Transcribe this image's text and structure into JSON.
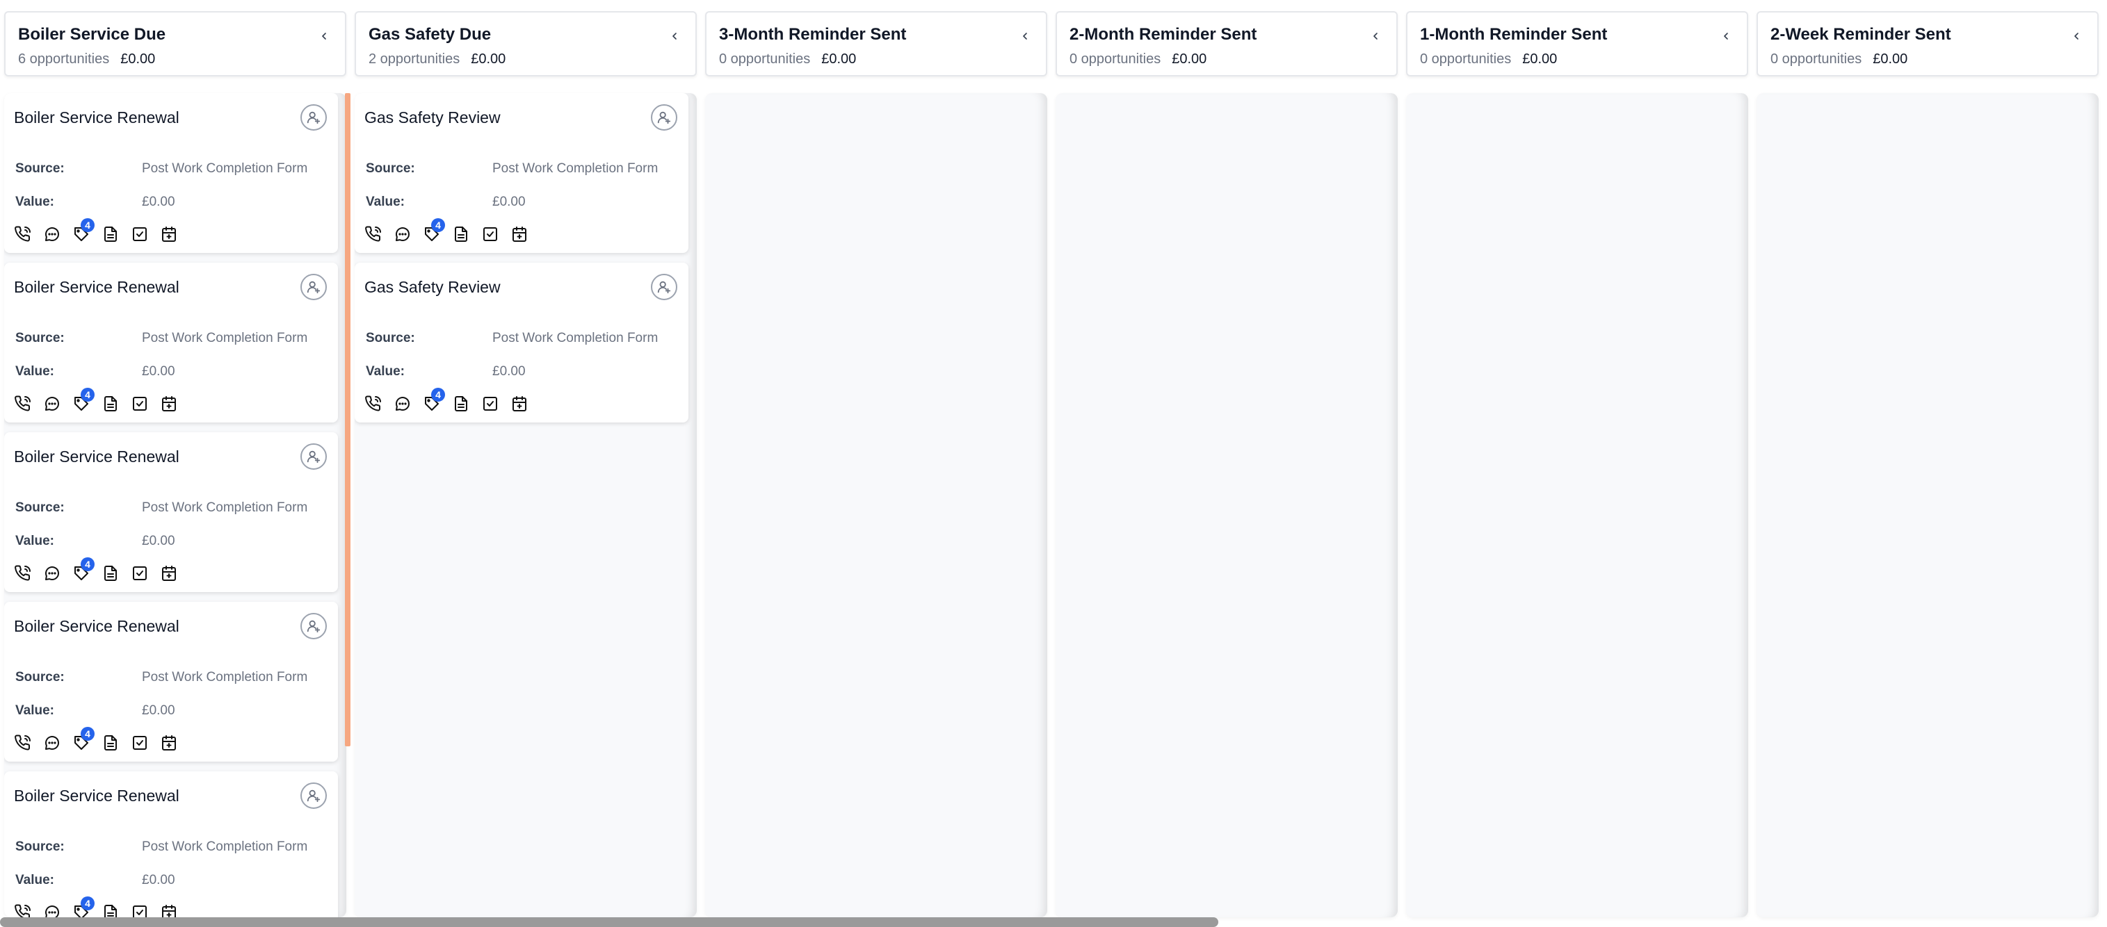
{
  "columns": [
    {
      "title": "Boiler Service Due",
      "count_label": "6 opportunities",
      "amount": "£0.00",
      "cards": [
        {
          "title": "Boiler Service Renewal",
          "source_label": "Source:",
          "source": "Post Work Completion Form",
          "value_label": "Value:",
          "value": "£0.00",
          "badge": "4"
        },
        {
          "title": "Boiler Service Renewal",
          "source_label": "Source:",
          "source": "Post Work Completion Form",
          "value_label": "Value:",
          "value": "£0.00",
          "badge": "4"
        },
        {
          "title": "Boiler Service Renewal",
          "source_label": "Source:",
          "source": "Post Work Completion Form",
          "value_label": "Value:",
          "value": "£0.00",
          "badge": "4"
        },
        {
          "title": "Boiler Service Renewal",
          "source_label": "Source:",
          "source": "Post Work Completion Form",
          "value_label": "Value:",
          "value": "£0.00",
          "badge": "4"
        },
        {
          "title": "Boiler Service Renewal",
          "source_label": "Source:",
          "source": "Post Work Completion Form",
          "value_label": "Value:",
          "value": "£0.00",
          "badge": "4"
        }
      ]
    },
    {
      "title": "Gas Safety Due",
      "count_label": "2 opportunities",
      "amount": "£0.00",
      "cards": [
        {
          "title": "Gas Safety Review",
          "source_label": "Source:",
          "source": "Post Work Completion Form",
          "value_label": "Value:",
          "value": "£0.00",
          "badge": "4"
        },
        {
          "title": "Gas Safety Review",
          "source_label": "Source:",
          "source": "Post Work Completion Form",
          "value_label": "Value:",
          "value": "£0.00",
          "badge": "4"
        }
      ]
    },
    {
      "title": "3-Month Reminder Sent",
      "count_label": "0 opportunities",
      "amount": "£0.00",
      "cards": []
    },
    {
      "title": "2-Month Reminder Sent",
      "count_label": "0 opportunities",
      "amount": "£0.00",
      "cards": []
    },
    {
      "title": "1-Month Reminder Sent",
      "count_label": "0 opportunities",
      "amount": "£0.00",
      "cards": []
    },
    {
      "title": "2-Week Reminder Sent",
      "count_label": "0 opportunities",
      "amount": "£0.00",
      "cards": []
    }
  ],
  "card_action_icons": [
    "phone-icon",
    "chat-icon",
    "tag-icon",
    "document-icon",
    "checkbox-icon",
    "calendar-icon"
  ],
  "colors": {
    "accent_scroll_indicator": "#f6a781",
    "badge": "#2563eb",
    "column_body": "#f8f9fb"
  }
}
